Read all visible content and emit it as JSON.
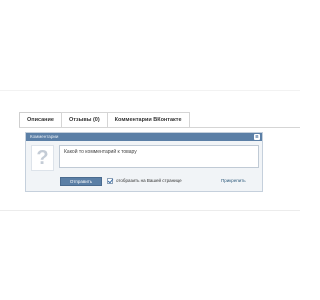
{
  "tabs": [
    {
      "label": "Описание",
      "active": true
    },
    {
      "label": "Отзывы (0)",
      "active": false
    },
    {
      "label": "Комментарии ВКонтакте",
      "active": false
    }
  ],
  "widget": {
    "title": "Комментарии",
    "badge": "B",
    "avatar_glyph": "?",
    "comment_text": "Какой то комментарий к товару",
    "send_label": "Отправить",
    "share_checked": true,
    "share_label": "отобразить на Вашей странице",
    "attach_label": "Прикрепить"
  },
  "colors": {
    "header": "#5b7fa6",
    "button": "#5b7fa6",
    "link": "#2b587a"
  }
}
